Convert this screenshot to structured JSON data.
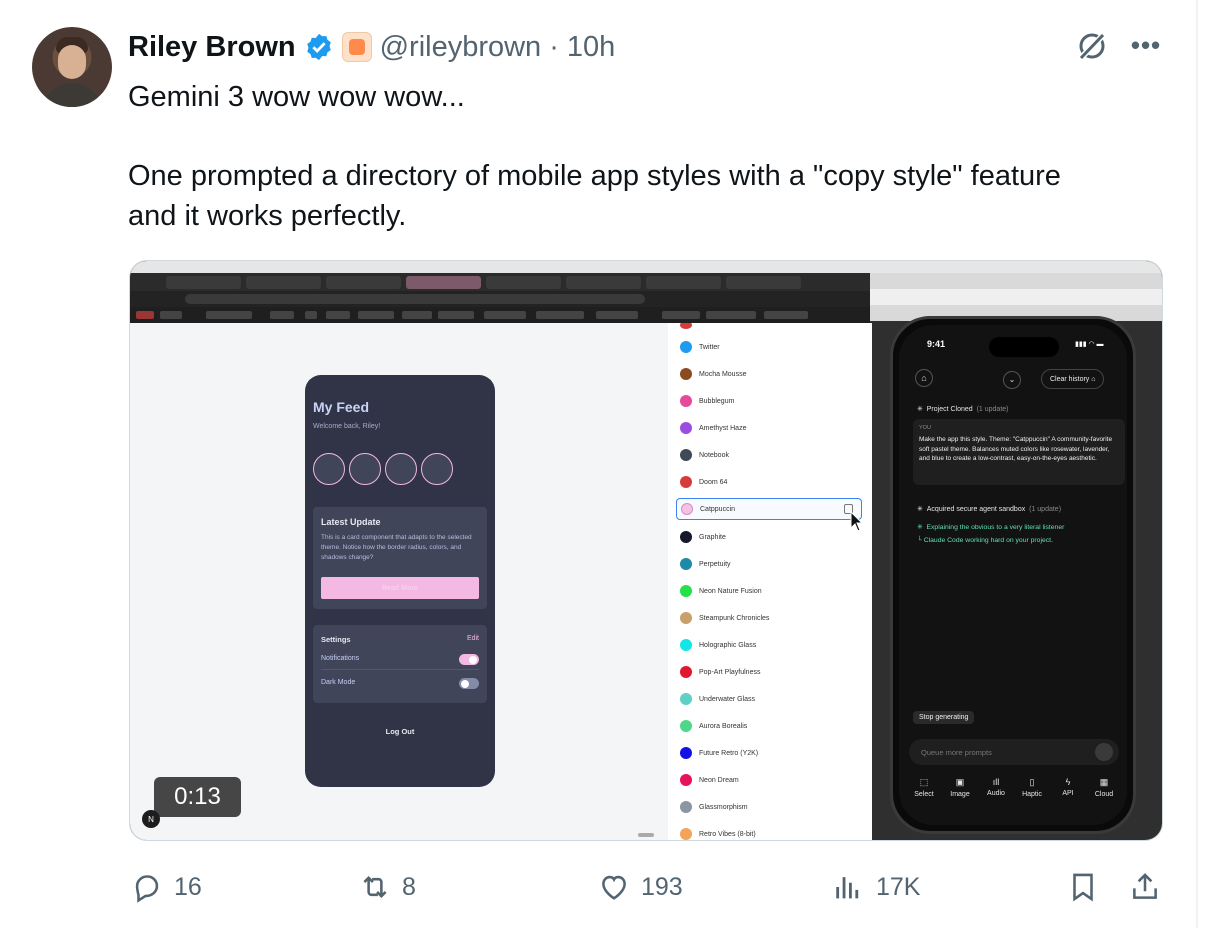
{
  "author": {
    "name": "Riley Brown",
    "handle": "@rileybrown",
    "separator": "·",
    "time": "10h"
  },
  "tweet": {
    "line1": "Gemini 3 wow wow wow...",
    "line2": "One prompted a directory of mobile app styles with a \"copy style\" feature",
    "line3": "and it works perfectly."
  },
  "video": {
    "timestamp": "0:13",
    "badge": "N",
    "left_app": {
      "title": "My Feed",
      "subtitle": "Welcome back, Riley!",
      "card_title": "Latest Update",
      "card_body": "This is a card component that adapts to the selected theme. Notice how the border radius, colors, and shadows change?",
      "card_button": "Read More",
      "settings_title": "Settings",
      "settings_edit": "Edit",
      "notifications": "Notifications",
      "dark_mode": "Dark Mode",
      "logout": "Log Out"
    },
    "theme_list": [
      {
        "name": "Twitter",
        "color": "#1d9bf0"
      },
      {
        "name": "Mocha Mousse",
        "color": "#8b4a1f"
      },
      {
        "name": "Bubblegum",
        "color": "#e84a9a"
      },
      {
        "name": "Amethyst Haze",
        "color": "#9b4de0"
      },
      {
        "name": "Notebook",
        "color": "#3f4a56"
      },
      {
        "name": "Doom 64",
        "color": "#d63b3b"
      },
      {
        "name": "Catppuccin",
        "color": "#f5c2e7"
      },
      {
        "name": "Graphite",
        "color": "#15172a"
      },
      {
        "name": "Perpetuity",
        "color": "#1c8aa8"
      },
      {
        "name": "Neon Nature Fusion",
        "color": "#22e14a"
      },
      {
        "name": "Steampunk Chronicles",
        "color": "#c9a06a"
      },
      {
        "name": "Holographic Glass",
        "color": "#12e6e6"
      },
      {
        "name": "Pop-Art Playfulness",
        "color": "#e0172f"
      },
      {
        "name": "Underwater Glass",
        "color": "#5fd0c6"
      },
      {
        "name": "Aurora Borealis",
        "color": "#4fd68a"
      },
      {
        "name": "Future Retro (Y2K)",
        "color": "#1212e6"
      },
      {
        "name": "Neon Dream",
        "color": "#e6125a"
      },
      {
        "name": "Glassmorphism",
        "color": "#8b96a3"
      },
      {
        "name": "Retro Vibes (8-bit)",
        "color": "#f2a45a"
      }
    ],
    "right_phone": {
      "time": "9:41",
      "clear_history": "Clear history",
      "project_cloned": "Project Cloned",
      "project_cloned_meta": "(1 update)",
      "you_label": "YOU",
      "you_message": "Make the app this style. Theme: \"Catppuccin\" A community-favorite soft pastel theme. Balances muted colors like rosewater, lavender, and blue to create a low-contrast, easy-on-the-eyes aesthetic.",
      "sandbox": "Acquired secure agent sandbox",
      "sandbox_meta": "(1 update)",
      "status1": "Explaining the obvious to a very literal listener",
      "status2": "Claude Code working hard on your project.",
      "stop": "Stop generating",
      "queue_placeholder": "Queue more prompts",
      "tools": [
        "Select",
        "Image",
        "Audio",
        "Haptic",
        "API",
        "Cloud"
      ]
    }
  },
  "actions": {
    "replies": "16",
    "reposts": "8",
    "likes": "193",
    "views": "17K"
  },
  "colors": {
    "text": "#0f1419",
    "muted": "#536471",
    "verified": "#1d9bf0"
  }
}
